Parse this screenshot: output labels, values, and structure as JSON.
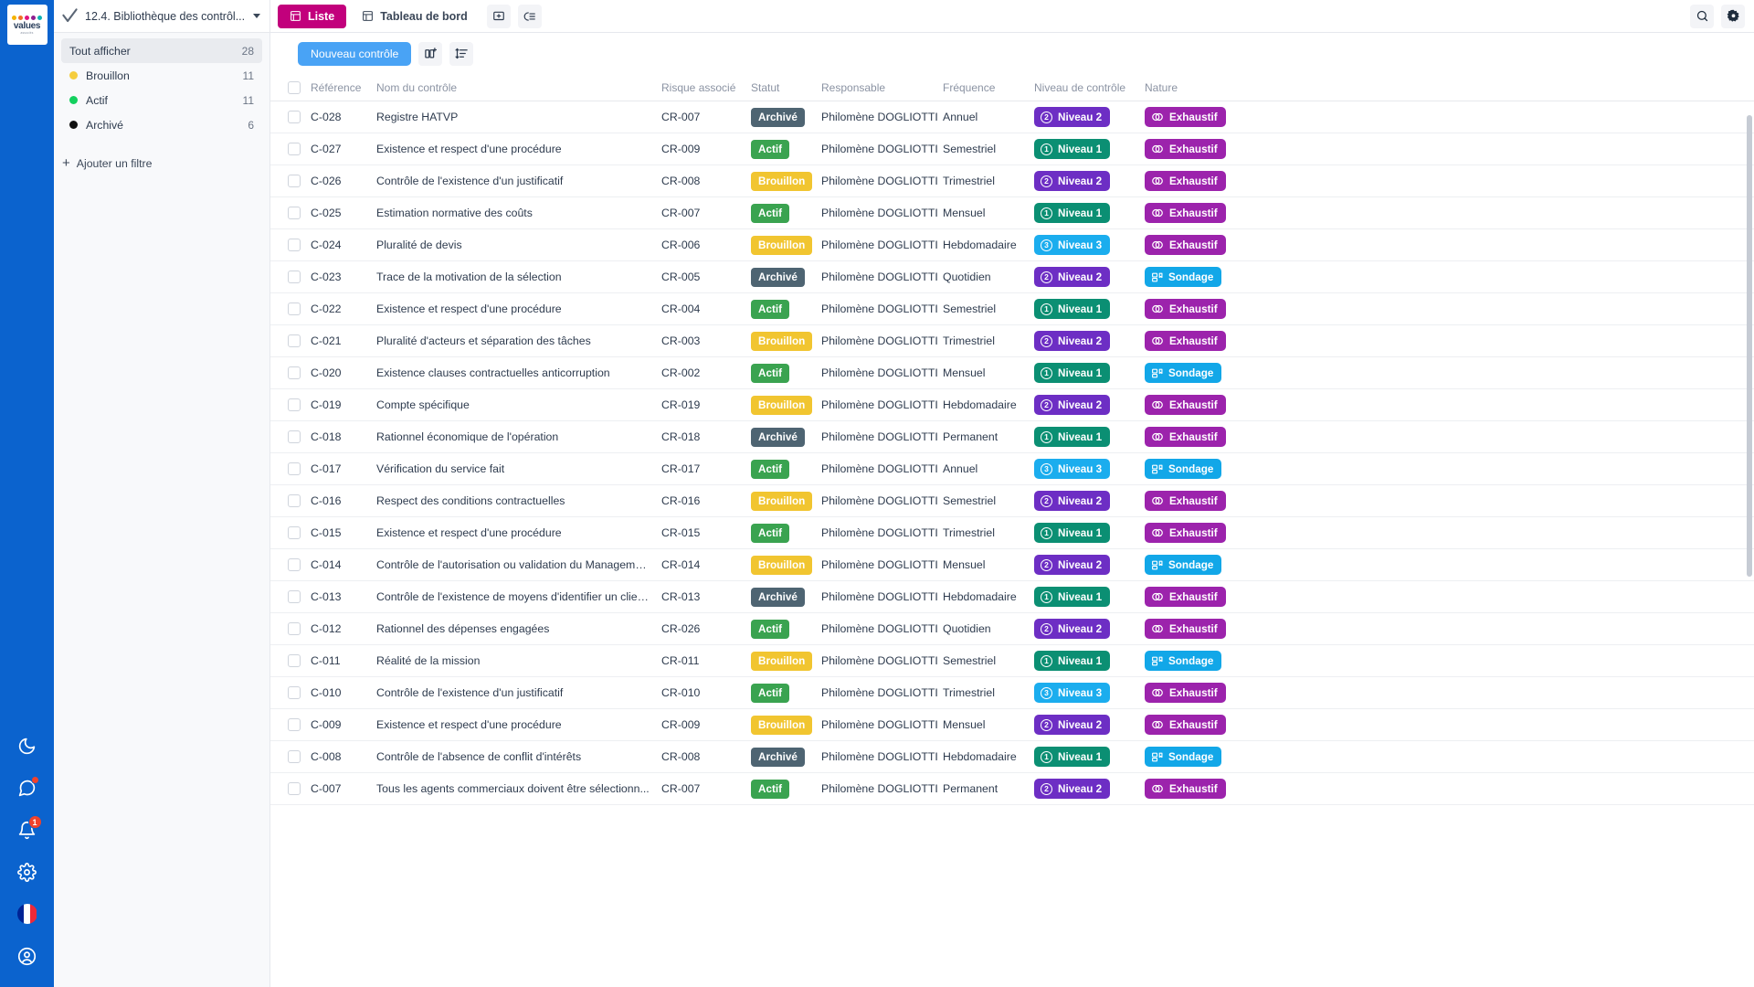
{
  "brand": {
    "logo_word": "values",
    "logo_sub": "associés",
    "dot_colors": [
      "#f5b301",
      "#f07025",
      "#e0157f",
      "#8e1f8f",
      "#0db3b3"
    ],
    "rail_bg": "#0b63ce"
  },
  "sidebar": {
    "title": "12.4. Bibliothèque des contrôl...",
    "items": [
      {
        "label": "Tout afficher",
        "count": "28",
        "dot": null,
        "active": true
      },
      {
        "label": "Brouillon",
        "count": "11",
        "dot": "#f5cd3d",
        "active": false
      },
      {
        "label": "Actif",
        "count": "11",
        "dot": "#13d05e",
        "active": false
      },
      {
        "label": "Archivé",
        "count": "6",
        "dot": "#111111",
        "active": false
      }
    ],
    "add_filter": "Ajouter un filtre"
  },
  "topbar": {
    "tabs": [
      {
        "label": "Liste",
        "icon": "list-view-icon",
        "selected": true
      },
      {
        "label": "Tableau de bord",
        "icon": "dashboard-icon",
        "selected": false
      }
    ],
    "add_view_icon": "add-view-icon",
    "collapse_icon": "collapse-rows-icon",
    "search_icon": "search-icon",
    "settings_icon": "gear-icon",
    "accent": "#c2007c"
  },
  "toolbar": {
    "new_label": "Nouveau contrôle",
    "columns_icon": "add-column-icon",
    "sort_icon": "sort-icon",
    "primary_color": "#49a3f5"
  },
  "table": {
    "columns": [
      "Référence",
      "Nom du contrôle",
      "Risque associé",
      "Statut",
      "Responsable",
      "Fréquence",
      "Niveau de contrôle",
      "Nature"
    ],
    "rows": [
      {
        "ref": "C-028",
        "nom": "Registre HATVP",
        "risque": "CR-007",
        "statut": "Archivé",
        "responsable": "Philomène DOGLIOTTI",
        "frequence": "Annuel",
        "niveau": "Niveau 2",
        "niveau_num": "2",
        "nature": "Exhaustif"
      },
      {
        "ref": "C-027",
        "nom": "Existence et respect d'une procédure",
        "risque": "CR-009",
        "statut": "Actif",
        "responsable": "Philomène DOGLIOTTI",
        "frequence": "Semestriel",
        "niveau": "Niveau 1",
        "niveau_num": "1",
        "nature": "Exhaustif"
      },
      {
        "ref": "C-026",
        "nom": "Contrôle de l'existence d'un justificatif",
        "risque": "CR-008",
        "statut": "Brouillon",
        "responsable": "Philomène DOGLIOTTI",
        "frequence": "Trimestriel",
        "niveau": "Niveau 2",
        "niveau_num": "2",
        "nature": "Exhaustif"
      },
      {
        "ref": "C-025",
        "nom": "Estimation normative des coûts",
        "risque": "CR-007",
        "statut": "Actif",
        "responsable": "Philomène DOGLIOTTI",
        "frequence": "Mensuel",
        "niveau": "Niveau 1",
        "niveau_num": "1",
        "nature": "Exhaustif"
      },
      {
        "ref": "C-024",
        "nom": "Pluralité de devis",
        "risque": "CR-006",
        "statut": "Brouillon",
        "responsable": "Philomène DOGLIOTTI",
        "frequence": "Hebdomadaire",
        "niveau": "Niveau 3",
        "niveau_num": "3",
        "nature": "Exhaustif"
      },
      {
        "ref": "C-023",
        "nom": "Trace de la motivation de la sélection",
        "risque": "CR-005",
        "statut": "Archivé",
        "responsable": "Philomène DOGLIOTTI",
        "frequence": "Quotidien",
        "niveau": "Niveau 2",
        "niveau_num": "2",
        "nature": "Sondage"
      },
      {
        "ref": "C-022",
        "nom": "Existence et respect d'une procédure",
        "risque": "CR-004",
        "statut": "Actif",
        "responsable": "Philomène DOGLIOTTI",
        "frequence": "Semestriel",
        "niveau": "Niveau 1",
        "niveau_num": "1",
        "nature": "Exhaustif"
      },
      {
        "ref": "C-021",
        "nom": "Pluralité d'acteurs et séparation des tâches",
        "risque": "CR-003",
        "statut": "Brouillon",
        "responsable": "Philomène DOGLIOTTI",
        "frequence": "Trimestriel",
        "niveau": "Niveau 2",
        "niveau_num": "2",
        "nature": "Exhaustif"
      },
      {
        "ref": "C-020",
        "nom": "Existence clauses contractuelles anticorruption",
        "risque": "CR-002",
        "statut": "Actif",
        "responsable": "Philomène DOGLIOTTI",
        "frequence": "Mensuel",
        "niveau": "Niveau 1",
        "niveau_num": "1",
        "nature": "Sondage"
      },
      {
        "ref": "C-019",
        "nom": "Compte spécifique",
        "risque": "CR-019",
        "statut": "Brouillon",
        "responsable": "Philomène DOGLIOTTI",
        "frequence": "Hebdomadaire",
        "niveau": "Niveau 2",
        "niveau_num": "2",
        "nature": "Exhaustif"
      },
      {
        "ref": "C-018",
        "nom": "Rationnel économique de l'opération",
        "risque": "CR-018",
        "statut": "Archivé",
        "responsable": "Philomène DOGLIOTTI",
        "frequence": "Permanent",
        "niveau": "Niveau 1",
        "niveau_num": "1",
        "nature": "Exhaustif"
      },
      {
        "ref": "C-017",
        "nom": "Vérification du service fait",
        "risque": "CR-017",
        "statut": "Actif",
        "responsable": "Philomène DOGLIOTTI",
        "frequence": "Annuel",
        "niveau": "Niveau 3",
        "niveau_num": "3",
        "nature": "Sondage"
      },
      {
        "ref": "C-016",
        "nom": "Respect des conditions contractuelles",
        "risque": "CR-016",
        "statut": "Brouillon",
        "responsable": "Philomène DOGLIOTTI",
        "frequence": "Semestriel",
        "niveau": "Niveau 2",
        "niveau_num": "2",
        "nature": "Exhaustif"
      },
      {
        "ref": "C-015",
        "nom": "Existence et respect d'une procédure",
        "risque": "CR-015",
        "statut": "Actif",
        "responsable": "Philomène DOGLIOTTI",
        "frequence": "Trimestriel",
        "niveau": "Niveau 1",
        "niveau_num": "1",
        "nature": "Exhaustif"
      },
      {
        "ref": "C-014",
        "nom": "Contrôle de l'autorisation ou validation du Manageme...",
        "risque": "CR-014",
        "statut": "Brouillon",
        "responsable": "Philomène DOGLIOTTI",
        "frequence": "Mensuel",
        "niveau": "Niveau 2",
        "niveau_num": "2",
        "nature": "Sondage"
      },
      {
        "ref": "C-013",
        "nom": "Contrôle de l'existence de moyens d'identifier un client...",
        "risque": "CR-013",
        "statut": "Archivé",
        "responsable": "Philomène DOGLIOTTI",
        "frequence": "Hebdomadaire",
        "niveau": "Niveau 1",
        "niveau_num": "1",
        "nature": "Exhaustif"
      },
      {
        "ref": "C-012",
        "nom": "Rationnel des dépenses engagées",
        "risque": "CR-026",
        "statut": "Actif",
        "responsable": "Philomène DOGLIOTTI",
        "frequence": "Quotidien",
        "niveau": "Niveau 2",
        "niveau_num": "2",
        "nature": "Exhaustif"
      },
      {
        "ref": "C-011",
        "nom": "Réalité de la mission",
        "risque": "CR-011",
        "statut": "Brouillon",
        "responsable": "Philomène DOGLIOTTI",
        "frequence": "Semestriel",
        "niveau": "Niveau 1",
        "niveau_num": "1",
        "nature": "Sondage"
      },
      {
        "ref": "C-010",
        "nom": "Contrôle de l'existence d'un justificatif",
        "risque": "CR-010",
        "statut": "Actif",
        "responsable": "Philomène DOGLIOTTI",
        "frequence": "Trimestriel",
        "niveau": "Niveau 3",
        "niveau_num": "3",
        "nature": "Exhaustif"
      },
      {
        "ref": "C-009",
        "nom": "Existence et respect d'une procédure",
        "risque": "CR-009",
        "statut": "Brouillon",
        "responsable": "Philomène DOGLIOTTI",
        "frequence": "Mensuel",
        "niveau": "Niveau 2",
        "niveau_num": "2",
        "nature": "Exhaustif"
      },
      {
        "ref": "C-008",
        "nom": "Contrôle de l'absence de conflit d'intérêts",
        "risque": "CR-008",
        "statut": "Archivé",
        "responsable": "Philomène DOGLIOTTI",
        "frequence": "Hebdomadaire",
        "niveau": "Niveau 1",
        "niveau_num": "1",
        "nature": "Sondage"
      },
      {
        "ref": "C-007",
        "nom": "Tous les agents commerciaux doivent être sélectionn...",
        "risque": "CR-007",
        "statut": "Actif",
        "responsable": "Philomène DOGLIOTTI",
        "frequence": "Permanent",
        "niveau": "Niveau 2",
        "niveau_num": "2",
        "nature": "Exhaustif"
      }
    ]
  },
  "rail": {
    "buttons": [
      {
        "icon": "moon-icon",
        "badge": null
      },
      {
        "icon": "chat-icon",
        "badge": "dot"
      },
      {
        "icon": "bell-icon",
        "badge": "1"
      },
      {
        "icon": "gear-icon",
        "badge": null
      },
      {
        "icon": "flag-fr-icon",
        "badge": null
      },
      {
        "icon": "account-icon",
        "badge": null
      }
    ]
  },
  "colors": {
    "status_brouillon": "#f1c530",
    "status_actif": "#3aa350",
    "status_archive": "#4e6472",
    "niveau_1": "#0b8f73",
    "niveau_2": "#6d2ec4",
    "niveau_3": "#1badee",
    "nature_exhaustif": "#9c23ac",
    "nature_sondage": "#12a7e8"
  }
}
